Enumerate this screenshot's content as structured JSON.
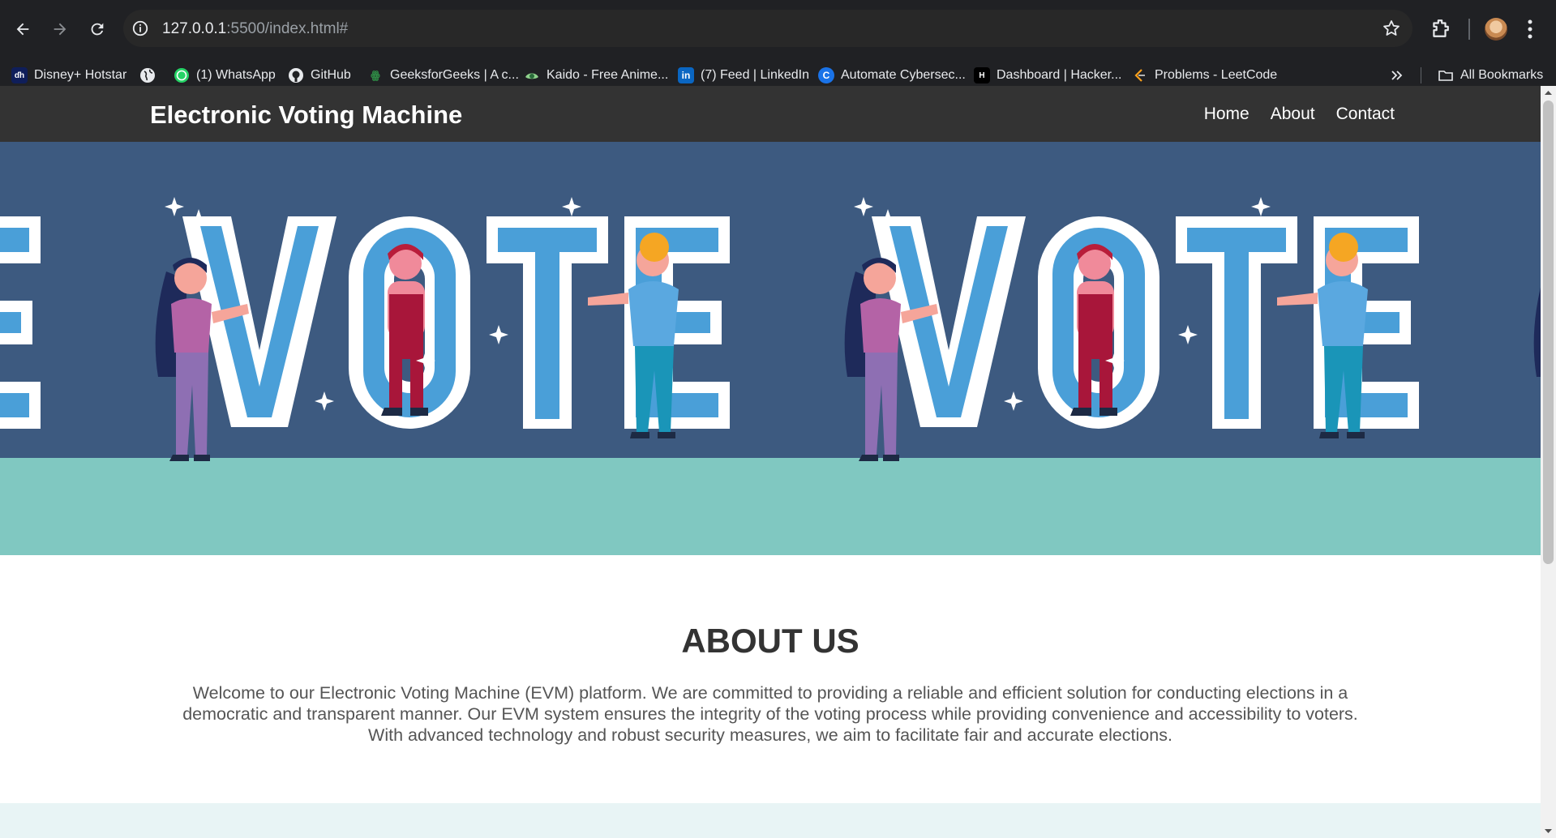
{
  "browser": {
    "url_host": "127.0.0.1",
    "url_rest": ":5500/index.html#",
    "bookmarks": [
      {
        "label": "Disney+ Hotstar",
        "icon": "hotstar-icon"
      },
      {
        "label": "",
        "icon": "globe-icon"
      },
      {
        "label": "(1) WhatsApp",
        "icon": "whatsapp-icon"
      },
      {
        "label": "GitHub",
        "icon": "github-icon"
      },
      {
        "label": "GeeksforGeeks | A c...",
        "icon": "geeksforgeeks-icon"
      },
      {
        "label": "Kaido - Free Anime...",
        "icon": "kaido-icon"
      },
      {
        "label": "(7) Feed | LinkedIn",
        "icon": "linkedin-icon"
      },
      {
        "label": "Automate Cybersec...",
        "icon": "cybersec-icon"
      },
      {
        "label": "Dashboard | Hacker...",
        "icon": "hackerrank-icon"
      },
      {
        "label": "Problems - LeetCode",
        "icon": "leetcode-icon"
      }
    ],
    "all_bookmarks_label": "All Bookmarks"
  },
  "site": {
    "title": "Electronic Voting Machine",
    "nav": [
      "Home",
      "About",
      "Contact"
    ]
  },
  "hero": {
    "banner_word": "VOTE",
    "colors": {
      "sky": "#3d5a80",
      "ground": "#80c8c1",
      "letter": "#ffffff",
      "letter_inner": "#4a9fd8"
    }
  },
  "about": {
    "heading": "ABOUT US",
    "lines": [
      "Welcome to our Electronic Voting Machine (EVM) platform. We are committed to providing a reliable and efficient solution for conducting elections in a",
      "democratic and transparent manner. Our EVM system ensures the integrity of the voting process while providing convenience and accessibility to voters.",
      "With advanced technology and robust security measures, we aim to facilitate fair and accurate elections."
    ]
  }
}
